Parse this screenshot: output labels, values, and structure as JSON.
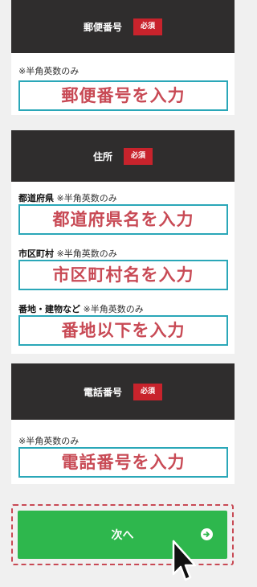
{
  "required_badge": "必須",
  "hint": "※半角英数のみ",
  "postal": {
    "title": "郵便番号",
    "placeholder": "郵便番号を入力"
  },
  "address": {
    "title": "住所",
    "prefecture": {
      "label": "都道府県",
      "placeholder": "都道府県名を入力"
    },
    "city": {
      "label": "市区町村",
      "placeholder": "市区町村名を入力"
    },
    "street": {
      "label": "番地・建物など",
      "placeholder": "番地以下を入力"
    }
  },
  "phone": {
    "title": "電話番号",
    "placeholder": "電話番号を入力"
  },
  "submit": {
    "label": "次へ"
  },
  "colors": {
    "header_bg": "#2f2d2d",
    "badge_bg": "#c8232c",
    "field_border": "#2aa7b8",
    "placeholder_text": "#c84a55",
    "submit_bg": "#2eb74d",
    "highlight_border": "#c84a55"
  },
  "icons": {
    "submit": "arrow-right-circle-icon",
    "cursor": "mouse-pointer-icon"
  }
}
